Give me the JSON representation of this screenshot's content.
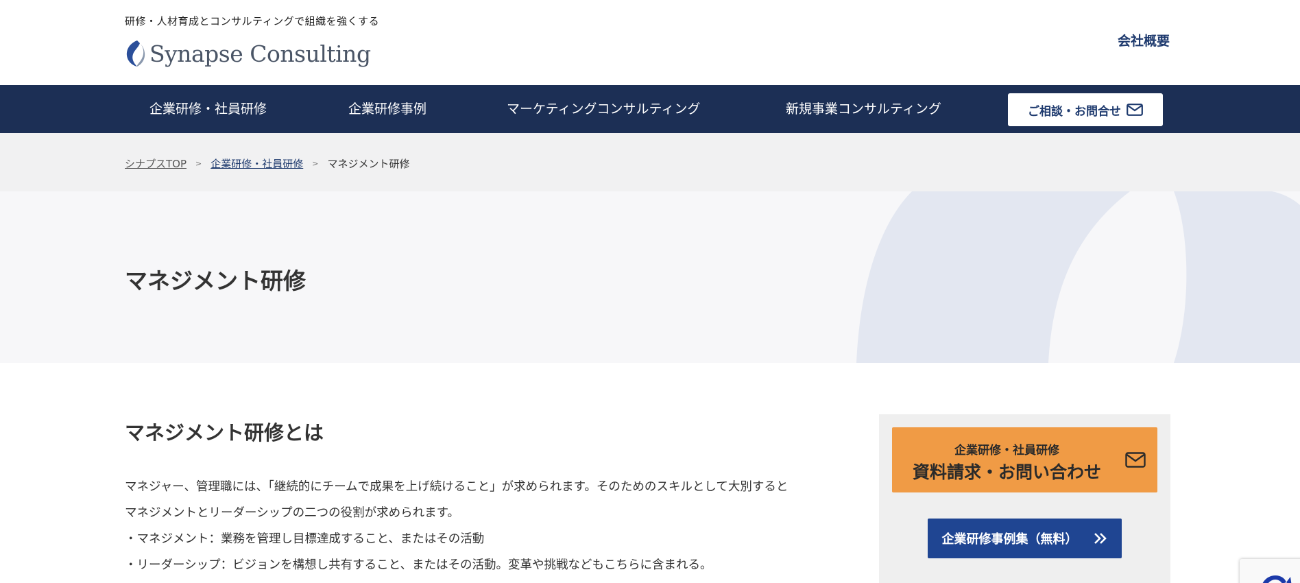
{
  "header": {
    "tagline": "研修・人材育成とコンサルティングで組織を強くする",
    "logo_text": "Synapse Consulting",
    "company_link": "会社概要"
  },
  "nav": {
    "items": [
      {
        "label": "企業研修・社員研修"
      },
      {
        "label": "企業研修事例"
      },
      {
        "label": "マーケティングコンサルティング"
      },
      {
        "label": "新規事業コンサルティング"
      }
    ],
    "cta_label": "ご相談・お問合せ"
  },
  "breadcrumb": {
    "items": [
      "シナプスTOP",
      "企業研修・社員研修",
      "マネジメント研修"
    ],
    "separator": ">"
  },
  "hero": {
    "title": "マネジメント研修"
  },
  "main": {
    "section_title": "マネジメント研修とは",
    "paragraph_lines": [
      "マネジャー、管理職には、「継続的にチームで成果を上げ続けること」が求められます。そのためのスキルとして大別すると",
      "マネジメントとリーダーシップの二つの役割が求められます。",
      "・マネジメント：業務を管理し目標達成すること、またはその活動",
      "・リーダーシップ：ビジョンを構想し共有すること、またはその活動。変革や挑戦などもこちらに含まれる。"
    ]
  },
  "sidebar": {
    "cta_sub": "企業研修・社員研修",
    "cta_main": "資料請求・お問い合わせ",
    "case_button": "企業研修事例集（無料）"
  },
  "icons": {
    "logo": "synapse-logo-mark",
    "mail": "mail-icon",
    "double_chevron": "double-chevron-right-icon"
  },
  "colors": {
    "nav_bg": "#1c2f55",
    "brand_blue": "#1e3a6e",
    "cta_orange": "#f09b45",
    "case_button_blue": "#1f4592",
    "breadcrumb_bg": "#f1f1f2",
    "hero_bg": "#f7f7f9",
    "hero_arc": "#e3e7f1"
  }
}
